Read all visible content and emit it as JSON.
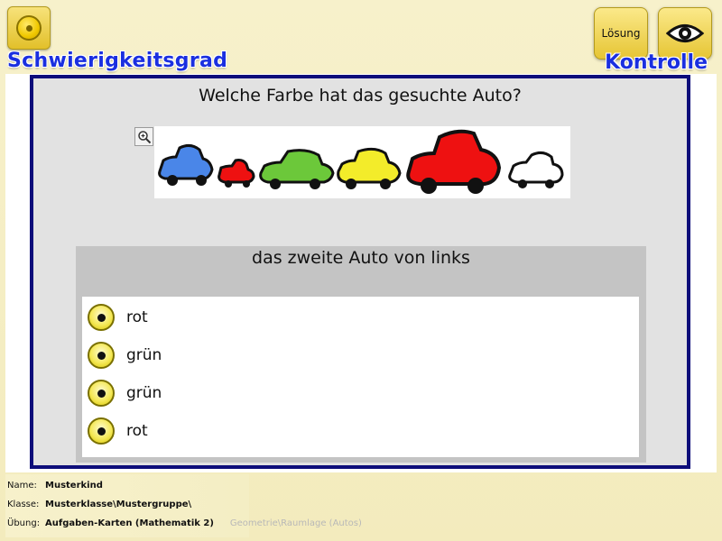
{
  "header": {
    "difficulty_label": "Schwierigkeitsgrad",
    "check_label": "Kontrolle",
    "solution_button_label": "Lösung",
    "difficulty_icon": "coin-icon",
    "check_icon": "eye-icon"
  },
  "main": {
    "question": "Welche Farbe hat das gesuchte Auto?",
    "zoom_icon": "magnifier-zoom-icon",
    "cars": [
      "blue",
      "red",
      "green",
      "yellow",
      "red",
      "white"
    ],
    "answer_prompt": "das zweite Auto von links",
    "options": [
      {
        "label": "rot"
      },
      {
        "label": "grün"
      },
      {
        "label": "grün"
      },
      {
        "label": "rot"
      }
    ]
  },
  "footer": {
    "name_label": "Name:",
    "name_value": "Musterkind",
    "class_label": "Klasse:",
    "class_value": "Musterklasse\\Mustergruppe\\",
    "exercise_label": "Übung:",
    "exercise_value": "Aufgaben-Karten (Mathematik 2)",
    "exercise_path": "Geometrie\\Raumlage (Autos)"
  },
  "colors": {
    "frame": "#0d0d7a",
    "title_blue": "#1a2fe0",
    "button_yellow": "#e6c534",
    "background": "#f4eec4"
  }
}
